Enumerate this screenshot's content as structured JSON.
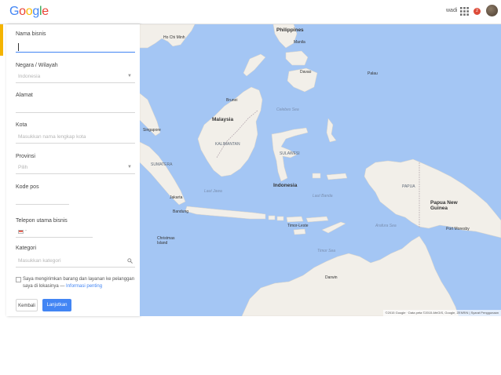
{
  "header": {
    "logo_letters": [
      {
        "ch": "G",
        "color": "#4285f4"
      },
      {
        "ch": "o",
        "color": "#ea4335"
      },
      {
        "ch": "o",
        "color": "#fbbc05"
      },
      {
        "ch": "g",
        "color": "#4285f4"
      },
      {
        "ch": "l",
        "color": "#34a853"
      },
      {
        "ch": "e",
        "color": "#ea4335"
      }
    ],
    "user_name": "wadi",
    "notification_count": "2",
    "apps_icon": "apps-grid-icon"
  },
  "form": {
    "business_name": {
      "label": "Nama bisnis",
      "value": ""
    },
    "country": {
      "label": "Negara / Wilayah",
      "value": "Indonesia"
    },
    "address": {
      "label": "Alamat",
      "value": ""
    },
    "city": {
      "label": "Kota",
      "placeholder": "Masukkan nama lengkap kota"
    },
    "province": {
      "label": "Provinsi",
      "value": "Pilih"
    },
    "postal_code": {
      "label": "Kode pos",
      "value": ""
    },
    "phone": {
      "label": "Telepon utama bisnis",
      "flag": "id-flag-icon",
      "separator": "-"
    },
    "category": {
      "label": "Kategori",
      "placeholder": "Masukkan kategori"
    },
    "delivery_checkbox": {
      "checked": false,
      "text": "Saya mengirimkan barang dan layanan ke pelanggan saya di lokasinya —",
      "link": "Informasi penting"
    },
    "buttons": {
      "back": "Kembali",
      "next": "Lanjutkan"
    }
  },
  "map": {
    "labels": {
      "philippines": "Philippines",
      "malaysia": "Malaysia",
      "indonesia": "Indonesia",
      "png": "Papua New Guinea",
      "singapore": "Singapore",
      "christmas_island": "Christmas Island",
      "timor_leste": "Timor-Leste",
      "celebes_sea": "Celebes Sea",
      "java_sea": "Laut Jawa",
      "banda_sea": "Laut Banda",
      "arafura_sea": "Arafura Sea",
      "timor_sea": "Timor Sea",
      "palau": "Palau",
      "brunei": "Brunei",
      "kalimantan": "KALIMANTAN",
      "jakarta": "Jakarta",
      "bandung": "Bandung",
      "sumatra": "SUMATERA",
      "papua": "PAPUA",
      "sulawesi": "SULAWESI",
      "manila": "Manila",
      "ho_chi_minh": "Ho Chi Minh",
      "davao": "Davao",
      "port_moresby": "Port Moresby",
      "darwin": "Darwin"
    },
    "footer": "©2015 Google · Data peta ©2015 AfriGIS, Google, ZENRIN | Syarat Penggunaan"
  },
  "colors": {
    "water": "#a4c6f4",
    "land": "#f2efe9",
    "accent": "#4285f4",
    "accent_strip": "#f4b400"
  }
}
